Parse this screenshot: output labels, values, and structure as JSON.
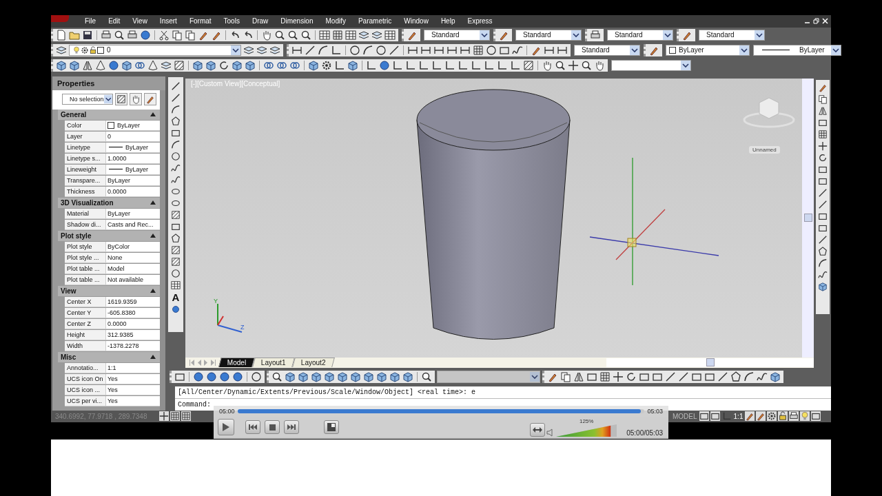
{
  "menu_bar": {
    "items": [
      "File",
      "Edit",
      "View",
      "Insert",
      "Format",
      "Tools",
      "Draw",
      "Dimension",
      "Modify",
      "Parametric",
      "Window",
      "Help",
      "Express"
    ]
  },
  "styles_toolbar": {
    "dropdowns": [
      "Standard",
      "Standard",
      "Standard",
      "Standard"
    ]
  },
  "layers_toolbar": {
    "layer": "0",
    "dim_style": "Standard",
    "property_dropdowns": [
      "ByLayer",
      "ByLayer"
    ]
  },
  "properties": {
    "title": "Properties",
    "selection": "No selection",
    "sections": [
      {
        "name": "General",
        "expanded": true,
        "rows": [
          {
            "label": "Color",
            "value": "ByLayer",
            "kind": "color"
          },
          {
            "label": "Layer",
            "value": "0",
            "kind": "text"
          },
          {
            "label": "Linetype",
            "value": "ByLayer",
            "kind": "line"
          },
          {
            "label": "Linetype s...",
            "value": "1.0000",
            "kind": "text"
          },
          {
            "label": "Lineweight",
            "value": "ByLayer",
            "kind": "line"
          },
          {
            "label": "Transpare...",
            "value": "ByLayer",
            "kind": "text"
          },
          {
            "label": "Thickness",
            "value": "0.0000",
            "kind": "text"
          }
        ]
      },
      {
        "name": "3D Visualization",
        "expanded": true,
        "rows": [
          {
            "label": "Material",
            "value": "ByLayer",
            "kind": "text"
          },
          {
            "label": "Shadow di...",
            "value": "Casts and Rec...",
            "kind": "text"
          }
        ]
      },
      {
        "name": "Plot style",
        "expanded": true,
        "rows": [
          {
            "label": "Plot style",
            "value": "ByColor",
            "kind": "text"
          },
          {
            "label": "Plot style ...",
            "value": "None",
            "kind": "text"
          },
          {
            "label": "Plot table ...",
            "value": "Model",
            "kind": "text"
          },
          {
            "label": "Plot table ...",
            "value": "Not available",
            "kind": "text"
          }
        ]
      },
      {
        "name": "View",
        "expanded": true,
        "rows": [
          {
            "label": "Center X",
            "value": "1619.9359",
            "kind": "text"
          },
          {
            "label": "Center Y",
            "value": "-605.8380",
            "kind": "text"
          },
          {
            "label": "Center Z",
            "value": "0.0000",
            "kind": "text"
          },
          {
            "label": "Height",
            "value": "312.9385",
            "kind": "text"
          },
          {
            "label": "Width",
            "value": "-1378.2278",
            "kind": "text"
          }
        ]
      },
      {
        "name": "Misc",
        "expanded": true,
        "rows": [
          {
            "label": "Annotatio...",
            "value": "1:1",
            "kind": "text"
          },
          {
            "label": "UCS icon On",
            "value": "Yes",
            "kind": "text"
          },
          {
            "label": "UCS icon ...",
            "value": "Yes",
            "kind": "text"
          },
          {
            "label": "UCS per vi...",
            "value": "Yes",
            "kind": "text"
          }
        ]
      }
    ]
  },
  "draw_toolbar": {
    "text_tool": "A"
  },
  "viewport": {
    "label": "[-][Custom View][Conceptual]",
    "view_name": "Unnamed",
    "ucs_labels": [
      "Y",
      "Z"
    ]
  },
  "layout_tabs": [
    {
      "label": "Model",
      "selected": true
    },
    {
      "label": "Layout1",
      "selected": false
    },
    {
      "label": "Layout2",
      "selected": false
    }
  ],
  "command_line": {
    "history": "[All/Center/Dynamic/Extents/Previous/Scale/Window/Object] <real time>: e",
    "prompt": "Command:"
  },
  "status_bar": {
    "coordinates": "340.6992, 77.9718 , 289.7348",
    "space": "MODEL",
    "annotation_scale": "1:1"
  },
  "video_player": {
    "elapsed": "05:00",
    "duration": "05:03",
    "level": 0.99,
    "volume": {
      "reading": "125%",
      "level": 0.9
    },
    "time": "05:00/05:03"
  }
}
